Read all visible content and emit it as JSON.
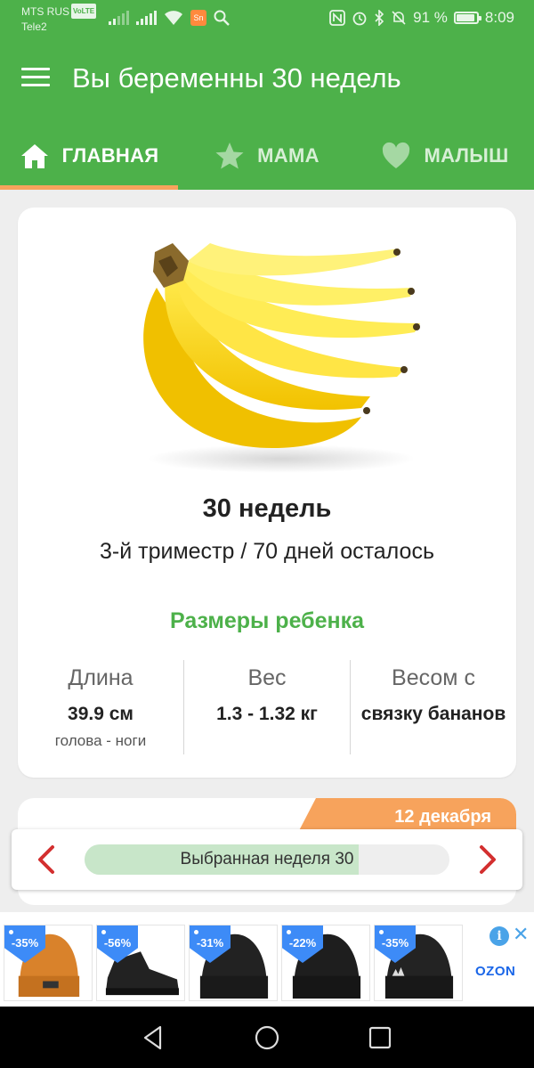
{
  "status_bar": {
    "carrier1": "MTS RUS",
    "volte": "VoLTE",
    "carrier2": "Tele2",
    "battery_percent": "91 %",
    "battery_level": 0.91,
    "time": "8:09",
    "message_icon_text": "Sn"
  },
  "app_bar": {
    "title": "Вы беременны 30 недель"
  },
  "tabs": [
    {
      "label": "ГЛАВНАЯ",
      "icon": "home-icon",
      "active": true
    },
    {
      "label": "МАМА",
      "icon": "star-icon",
      "active": false
    },
    {
      "label": "МАЛЫШ",
      "icon": "heart-icon",
      "active": false
    }
  ],
  "main_card": {
    "image": "banana-bunch",
    "weeks": "30 недель",
    "trimester": "3-й триместр / 70 дней осталось",
    "sizes_title": "Размеры ребенка",
    "stats": [
      {
        "label": "Длина",
        "value": "39.9 см",
        "sub": "голова - ноги"
      },
      {
        "label": "Вес",
        "value": "1.3 - 1.32 кг",
        "sub": ""
      },
      {
        "label": "Весом с",
        "value": "связку бананов",
        "sub": ""
      }
    ]
  },
  "second_card": {
    "date": "12 декабря"
  },
  "week_nav": {
    "label": "Выбранная неделя 30",
    "progress": 0.75
  },
  "ad": {
    "brand": "OZON",
    "items": [
      {
        "discount": "-35%",
        "product": "orange-beanie"
      },
      {
        "discount": "-56%",
        "product": "black-sneaker"
      },
      {
        "discount": "-31%",
        "product": "black-beanie"
      },
      {
        "discount": "-22%",
        "product": "black-beanie"
      },
      {
        "discount": "-35%",
        "product": "black-beanie-adidas"
      }
    ]
  },
  "colors": {
    "primary": "#4db14a",
    "accent": "#f7a35c",
    "nav_arrow": "#d32f2f"
  }
}
